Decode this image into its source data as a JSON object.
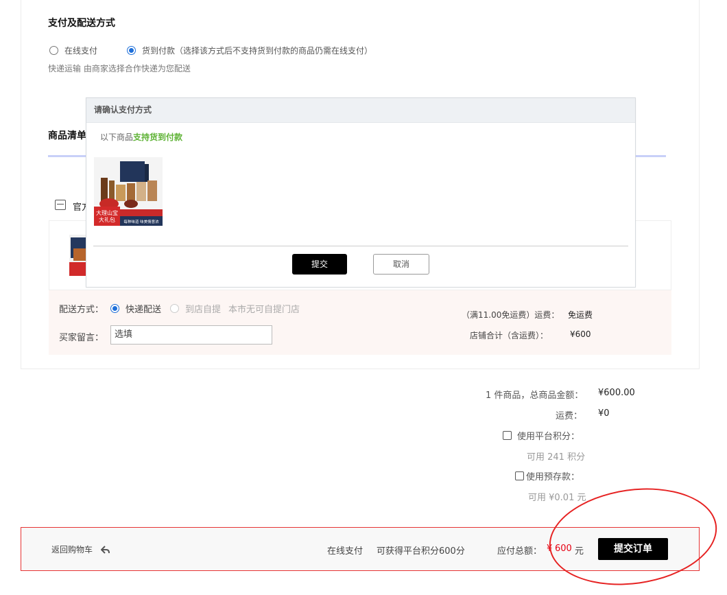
{
  "payment": {
    "title": "支付及配送方式",
    "online_label": "在线支付",
    "cod_label": "货到付款（选择该方式后不支持货到付款的商品仍需在线支付）",
    "delivery_note": "快递运输 由商家选择合作快递为您配送"
  },
  "goods": {
    "title": "商品清单",
    "shop_name": "官方",
    "shipping_label": "配送方式：",
    "express_label": "快递配送",
    "pickup_label": "到店自提",
    "pickup_note": "本市无可自提门店",
    "message_label": "买家留言：",
    "message_placeholder": "选填",
    "freight_rule": "（满11.00免运费）运费：",
    "freight_value": "免运费",
    "shop_total_label": "店铺合计（含运费）：",
    "shop_total_value": "¥600"
  },
  "summary": {
    "goods_total_label": "1 件商品，总商品金额：",
    "goods_total_value": "¥600.00",
    "freight_label": "运费：",
    "freight_value": "¥0",
    "points_label": "使用平台积分：",
    "points_available": "可用 241 积分",
    "deposit_label": "使用预存款：",
    "deposit_available": "可用 ¥0.01 元"
  },
  "bottom_bar": {
    "back_label": "返回购物车",
    "pay_method": "在线支付",
    "points_earn": "可获得平台积分600分",
    "total_label": "应付总额：",
    "total_currency": "¥",
    "total_value": "600",
    "total_unit": "元",
    "submit_label": "提交订单"
  },
  "modal": {
    "title": "请确认支付方式",
    "message_prefix": "以下商品",
    "message_highlight": "支持货到付款",
    "product_image_text_1": "大理山宝",
    "product_image_text_2": "大礼包",
    "product_image_text_3": "每种味道 味美情意浓",
    "ok_label": "提交",
    "cancel_label": "取消"
  },
  "colors": {
    "accent_black": "#000000",
    "price_red": "#e60012",
    "highlight_green": "#5fb336",
    "radio_blue": "#1e6fd9"
  }
}
